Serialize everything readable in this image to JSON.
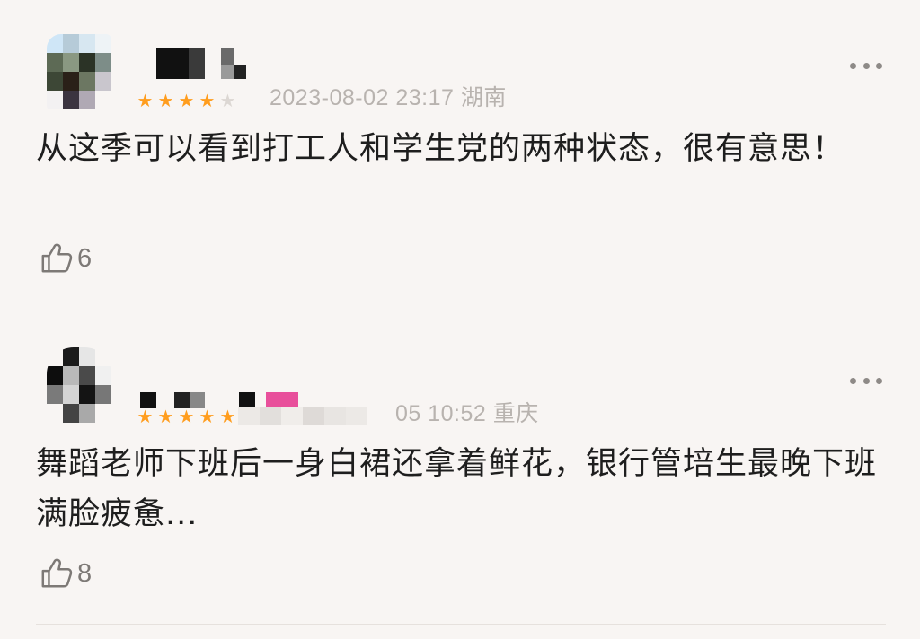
{
  "comments": [
    {
      "meta": "2023-08-02 23:17 湖南",
      "rating": 4,
      "text": "从这季可以看到打工人和学生党的两种状态，很有意思！",
      "likes": "6",
      "avatar_colors": [
        "#cfe6f7",
        "#b6cbd8",
        "#d7e7f1",
        "#eef3f6",
        "#5d6a55",
        "#8a9882",
        "#2b3326",
        "#7d8d88",
        "#3d4736",
        "#2a2018",
        "#6c7762",
        "#c9c6cd",
        "#f3f1f2",
        "#3b3440",
        "#b0a9b4",
        "#f8f5f3"
      ],
      "username_blocks": [
        "#111111",
        "#3a3a3a",
        "#9a9a9a",
        "#222222"
      ]
    },
    {
      "meta": "05 10:52 重庆",
      "rating": 5,
      "text": "舞蹈老师下班后一身白裙还拿着鲜花，银行管培生最晚下班满脸疲惫...",
      "likes": "8",
      "avatar_colors": [
        "#f8f5f3",
        "#1b1b1b",
        "#e6e6e6",
        "#f8f5f3",
        "#0d0d0d",
        "#b9b9b9",
        "#4a4a4a",
        "#f0f0f0",
        "#7a7a7a",
        "#d4d4d4",
        "#141414",
        "#777777",
        "#f8f5f3",
        "#444444",
        "#a9a9a9",
        "#f8f5f3"
      ],
      "username_blocks": [
        "#111111",
        "#222222",
        "#888888",
        "#111111",
        "#e84f9b"
      ]
    }
  ],
  "colors": {
    "background": "#f8f5f3",
    "star_active": "#ff9d1e",
    "star_inactive": "#dcd7d3",
    "meta_text": "#b8b3af",
    "divider": "#e6e1dd"
  },
  "icons": {
    "like": "thumbs-up-icon",
    "more": "more-dots-icon",
    "star": "star-icon"
  }
}
